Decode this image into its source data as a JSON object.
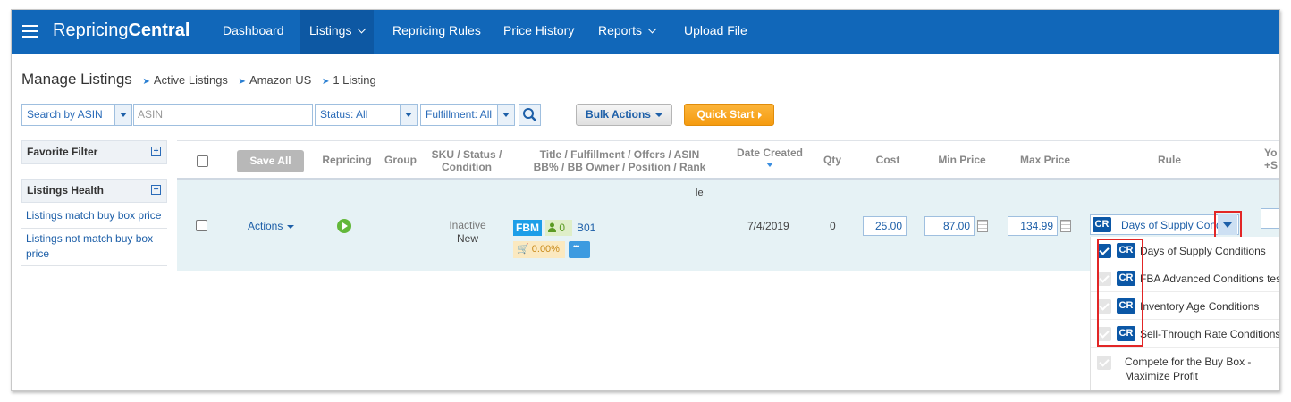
{
  "nav": {
    "brand_part1": "Repricing",
    "brand_part2": "Central",
    "items": [
      {
        "label": "Dashboard"
      },
      {
        "label": "Listings"
      },
      {
        "label": "Repricing Rules"
      },
      {
        "label": "Price History"
      },
      {
        "label": "Reports"
      },
      {
        "label": "Upload File"
      }
    ]
  },
  "breadcrumb": {
    "title": "Manage Listings",
    "items": [
      "Active Listings",
      "Amazon US",
      "1 Listing"
    ]
  },
  "filters": {
    "search_by": "Search by ASIN",
    "asin_placeholder": "ASIN",
    "status": "Status: All",
    "fulfillment": "Fulfillment: All",
    "bulk_actions": "Bulk Actions",
    "quick_start": "Quick Start"
  },
  "sidebar": {
    "favorite_filter": "Favorite Filter",
    "favorite_toggle": "+",
    "listings_health": "Listings Health",
    "health_toggle": "−",
    "links": [
      "Listings match buy box price",
      "Listings not match buy box price"
    ]
  },
  "table": {
    "save_all": "Save All",
    "headers": {
      "repricing": "Repricing",
      "group": "Group",
      "sku_line1": "SKU / Status /",
      "sku_line2": "Condition",
      "title_line1": "Title / Fulfillment / Offers / ASIN",
      "title_line2": "BB% / BB Owner / Position / Rank",
      "date_created": "Date Created",
      "qty": "Qty",
      "cost": "Cost",
      "min_price": "Min Price",
      "max_price": "Max Price",
      "rule": "Rule",
      "cut_line1": "Yo",
      "cut_line2": "+S"
    },
    "row": {
      "actions": "Actions",
      "title_fragment": "le",
      "status": "Inactive",
      "condition": "New",
      "fulfillment": "FBM",
      "offers": "0",
      "asin": "B01",
      "bb_percent": "0.00%",
      "date_created": "7/4/2019",
      "qty": "0",
      "cost": "25.00",
      "min_price": "87.00",
      "max_price": "134.99",
      "rule": "Days of Supply Cond"
    }
  },
  "rule_dropdown": {
    "tag": "CR",
    "options": [
      {
        "label": "Days of Supply Conditions",
        "checked": true
      },
      {
        "label": "FBA Advanced Conditions test",
        "checked": false
      },
      {
        "label": "Inventory Age Conditions",
        "checked": false
      },
      {
        "label": "Sell-Through Rate Conditions",
        "checked": false
      }
    ],
    "last_option": "Compete for the Buy Box - Maximize Profit"
  },
  "colors": {
    "nav_bg": "#1167b9",
    "row_bg": "#e6f2f5",
    "accent": "#1d5fa8",
    "highlight": "#e22626",
    "quick_start": "#f59b0f"
  }
}
